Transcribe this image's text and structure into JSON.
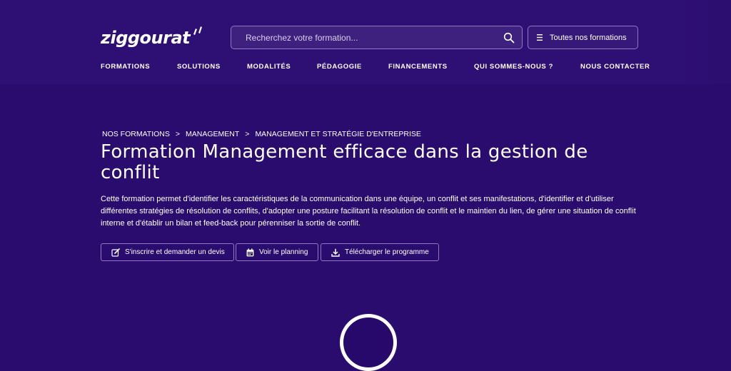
{
  "brand": {
    "name": "ziggourat"
  },
  "search": {
    "placeholder": "Recherchez votre formation..."
  },
  "all_trainings_button": {
    "label": "Toutes nos formations"
  },
  "nav": {
    "items": [
      {
        "label": "FORMATIONS"
      },
      {
        "label": "SOLUTIONS"
      },
      {
        "label": "MODALITÉS"
      },
      {
        "label": "PÉDAGOGIE"
      },
      {
        "label": "FINANCEMENTS"
      },
      {
        "label": "QUI SOMMES-NOUS ?"
      },
      {
        "label": "NOUS CONTACTER"
      }
    ]
  },
  "breadcrumb": {
    "items": [
      "NOS FORMATIONS",
      "MANAGEMENT",
      "MANAGEMENT ET STRATÉGIE D'ENTREPRISE"
    ],
    "separator": ">"
  },
  "page": {
    "title": "Formation Management efficace dans la gestion de conflit",
    "description": "Cette formation permet d'identifier les caractéristiques de la communication dans une équipe, un conflit et ses manifestations, d'identifier et d'utiliser différentes stratégies de résolution de conflits, d'adopter une posture facilitant la résolution de conflit et le maintien du lien, de gérer une situation de conflit interne et d'établir un bilan et feed-back pour pérenniser la sortie de conflit."
  },
  "actions": [
    {
      "label": "S'inscrire et demander un devis",
      "icon": "edit-icon"
    },
    {
      "label": "Voir le planning",
      "icon": "calendar-icon"
    },
    {
      "label": "Télécharger le programme",
      "icon": "download-icon"
    }
  ],
  "colors": {
    "background": "#2a0c6e",
    "header": "#2e0f73",
    "border": "#8e7ac0",
    "text": "#ffffff"
  }
}
